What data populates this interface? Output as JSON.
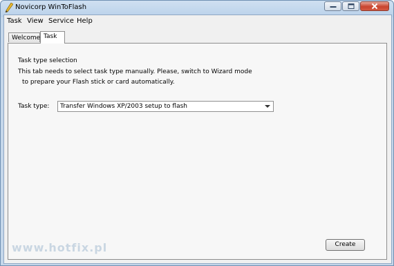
{
  "window": {
    "title": "Novicorp WinToFlash",
    "icon": "pen-icon"
  },
  "menu": [
    {
      "label": "Task"
    },
    {
      "label": "View"
    },
    {
      "label": "Service"
    },
    {
      "label": "Help"
    }
  ],
  "tabs": [
    {
      "label": "Welcome!",
      "active": false
    },
    {
      "label": "Task",
      "active": true
    }
  ],
  "panel": {
    "heading": "Task type selection",
    "desc_line1": "This tab needs to select task type manually. Please, switch to Wizard mode",
    "desc_line2": "to prepare your Flash stick or card automatically.",
    "task_type_label": "Task type:",
    "task_type_value": "Transfer Windows XP/2003 setup to flash",
    "create_label": "Create"
  },
  "watermark": "www.hotfix.pl"
}
